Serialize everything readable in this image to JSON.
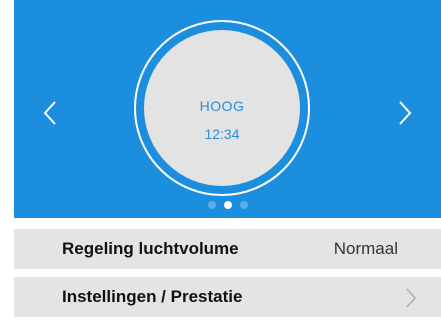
{
  "hero": {
    "mode_label": "HOOG",
    "time_label": "12:34",
    "prev_icon": "chevron-left-icon",
    "next_icon": "chevron-right-icon",
    "page_indicator": {
      "count": 3,
      "active_index": 1
    }
  },
  "settings": {
    "air_volume": {
      "label": "Regeling luchtvolume",
      "value": "Normaal"
    },
    "performance": {
      "label": "Instellingen / Prestatie",
      "icon": "chevron-right-icon"
    }
  },
  "colors": {
    "accent_blue": "#1b8ede",
    "dial_face": "#e3e3e3",
    "row_background": "#e4e4e4",
    "dot_inactive": "#5aacea"
  }
}
